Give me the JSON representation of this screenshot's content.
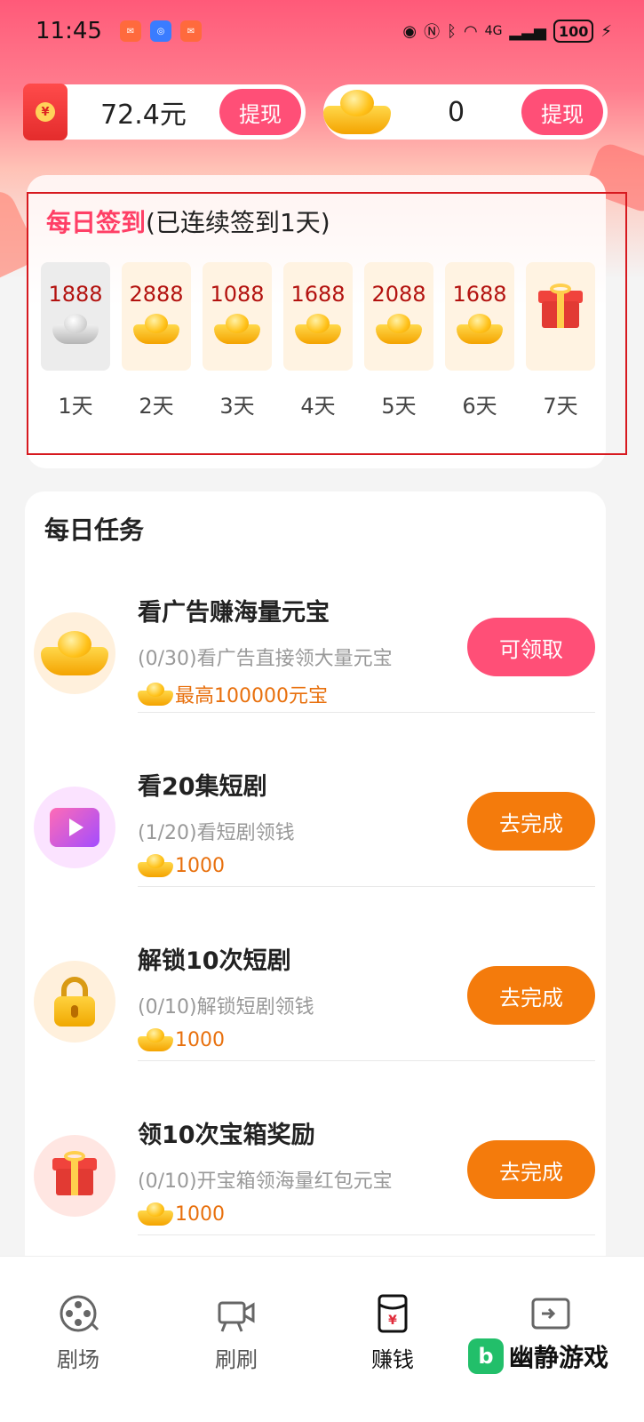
{
  "status_bar": {
    "time": "11:45",
    "network": "4G",
    "battery": "100"
  },
  "balance": {
    "cash_value": "72.4元",
    "cash_button": "提现",
    "ingot_value": "0",
    "ingot_button": "提现"
  },
  "signin": {
    "title": "每日签到",
    "subtitle": "(已连续签到1天)",
    "days": [
      {
        "amount": "1888",
        "label": "1天",
        "state": "done"
      },
      {
        "amount": "2888",
        "label": "2天",
        "state": "pending"
      },
      {
        "amount": "1088",
        "label": "3天",
        "state": "pending"
      },
      {
        "amount": "1688",
        "label": "4天",
        "state": "pending"
      },
      {
        "amount": "2088",
        "label": "5天",
        "state": "pending"
      },
      {
        "amount": "1688",
        "label": "6天",
        "state": "pending"
      },
      {
        "amount": "",
        "label": "7天",
        "state": "gift"
      }
    ]
  },
  "tasks": {
    "title": "每日任务",
    "items": [
      {
        "name": "看广告赚海量元宝",
        "desc": "(0/30)看广告直接领大量元宝",
        "reward": "最高100000元宝",
        "button": "可领取",
        "icon": "gold-ingot-icon"
      },
      {
        "name": "看20集短剧",
        "desc": "(1/20)看短剧领钱",
        "reward": "1000",
        "button": "去完成",
        "icon": "video-play-icon"
      },
      {
        "name": "解锁10次短剧",
        "desc": "(0/10)解锁短剧领钱",
        "reward": "1000",
        "button": "去完成",
        "icon": "lock-icon"
      },
      {
        "name": "领10次宝箱奖励",
        "desc": "(0/10)开宝箱领海量红包元宝",
        "reward": "1000",
        "button": "去完成",
        "icon": "gift-box-icon"
      }
    ]
  },
  "nav": {
    "items": [
      {
        "label": "剧场",
        "icon": "film-reel-icon"
      },
      {
        "label": "刷刷",
        "icon": "video-camera-icon"
      },
      {
        "label": "赚钱",
        "icon": "red-packet-icon"
      },
      {
        "label": "",
        "icon": "wallet-icon"
      }
    ]
  },
  "watermark": {
    "text": "幽静游戏"
  },
  "colors": {
    "accent_pink": "#ff4f77",
    "accent_orange": "#f47b0c",
    "signin_title": "#ff3f66",
    "amount_red": "#b3120f"
  }
}
